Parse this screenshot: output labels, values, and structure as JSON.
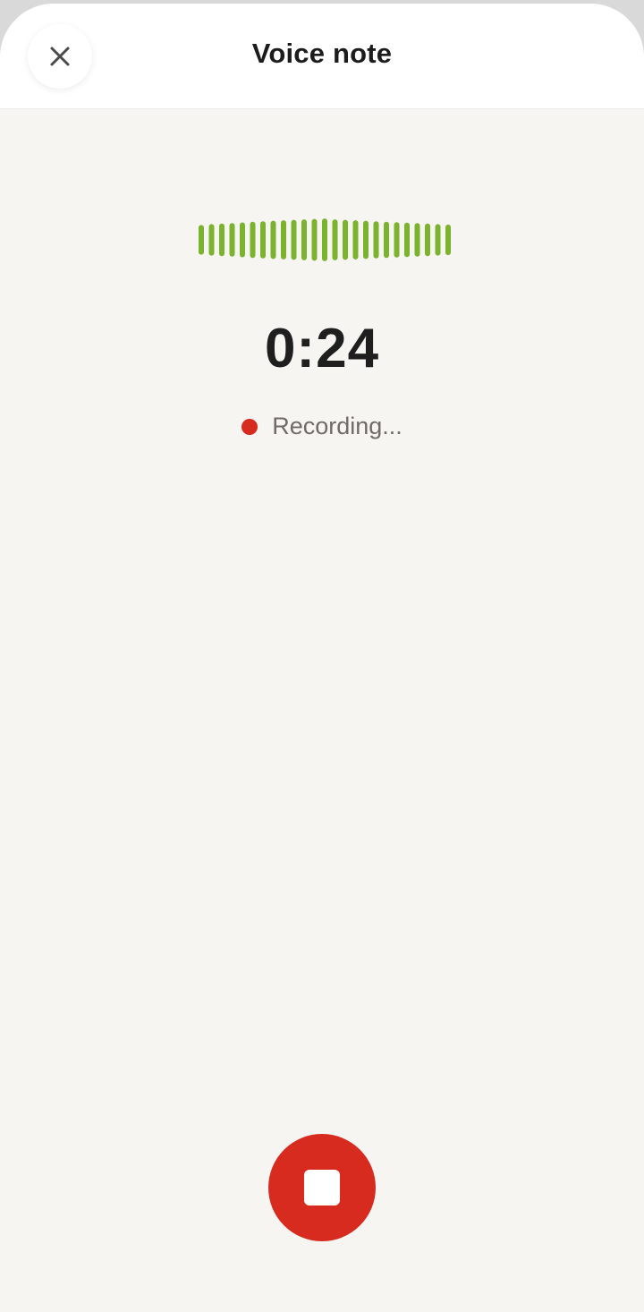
{
  "header": {
    "title": "Voice note",
    "close_icon": "close-icon"
  },
  "recorder": {
    "timer": "0:24",
    "status": "Recording...",
    "waveform_color": "#7cb32e",
    "recording_color": "#d72b20",
    "stop_icon": "stop-icon",
    "waveform_levels": [
      0.64,
      0.68,
      0.7,
      0.72,
      0.75,
      0.78,
      0.8,
      0.82,
      0.84,
      0.86,
      0.88,
      0.9,
      0.92,
      0.88,
      0.86,
      0.84,
      0.82,
      0.8,
      0.78,
      0.76,
      0.74,
      0.72,
      0.7,
      0.68,
      0.66
    ]
  }
}
